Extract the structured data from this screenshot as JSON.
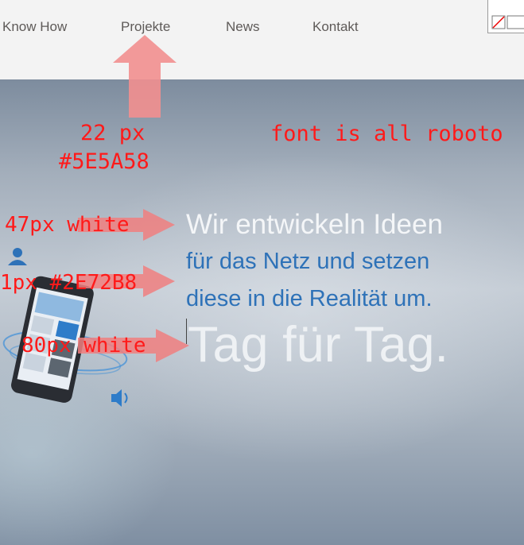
{
  "nav": {
    "items": [
      "Know How",
      "Projekte",
      "News",
      "Kontakt"
    ]
  },
  "hero": {
    "line1": "Wir entwickeln Ideen",
    "line2": "für das Netz und setzen",
    "line3": "diese in die Realität um.",
    "line4": "Tag für Tag."
  },
  "annotations": {
    "nav_size": "22 px",
    "nav_color": "#5E5A58",
    "font_note": "font is all roboto",
    "line1_note": "47px white",
    "line2_note": "1px #2E72B8",
    "line4_note": "80px white"
  },
  "colors": {
    "nav_text": "#5E5A58",
    "hero_blue": "#2E72B8",
    "hero_white": "#FFFFFF",
    "annotation_red": "#FF1A1A"
  }
}
